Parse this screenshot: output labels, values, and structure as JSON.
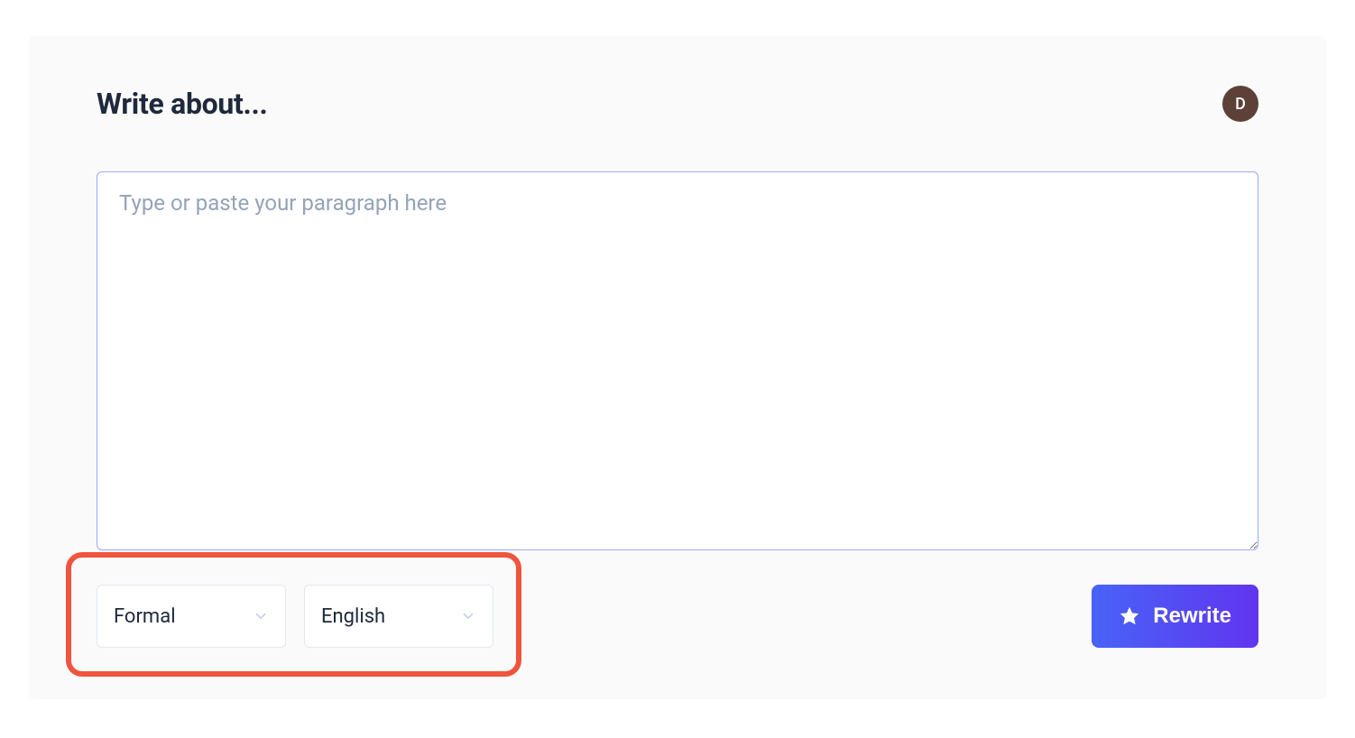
{
  "header": {
    "title": "Write about...",
    "avatar_initial": "D"
  },
  "input": {
    "placeholder": "Type or paste your paragraph here",
    "value": ""
  },
  "controls": {
    "tone_select": {
      "selected": "Formal"
    },
    "language_select": {
      "selected": "English"
    },
    "rewrite_button_label": "Rewrite"
  }
}
